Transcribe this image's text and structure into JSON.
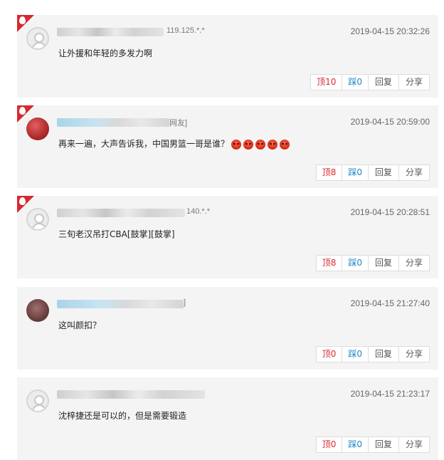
{
  "comments": [
    {
      "hot": true,
      "avatar": "default",
      "user_suffix": "119.125.*.*",
      "time": "2019-04-15 20:32:26",
      "text": "让外援和年轻的多发力啊",
      "emoji_count": 0,
      "up_label": "顶10",
      "down_label": "踩0",
      "reply_label": "回复",
      "share_label": "分享"
    },
    {
      "hot": true,
      "avatar": "red",
      "user_suffix": "网友]",
      "time": "2019-04-15 20:59:00",
      "text": "再来一遍，大声告诉我，中国男篮一哥是谁？",
      "emoji_count": 5,
      "emoji_icon": "angry-face-emoji",
      "up_label": "顶8",
      "down_label": "踩0",
      "reply_label": "回复",
      "share_label": "分享"
    },
    {
      "hot": true,
      "avatar": "default",
      "user_suffix": "140.*.*",
      "time": "2019-04-15 20:28:51",
      "text": "三旬老汉吊打CBA[鼓掌][鼓掌]",
      "emoji_count": 0,
      "up_label": "顶8",
      "down_label": "踩0",
      "reply_label": "回复",
      "share_label": "分享"
    },
    {
      "hot": false,
      "avatar": "brown",
      "user_suffix": "]",
      "time": "2019-04-15 21:27:40",
      "text": "这叫颜扣？",
      "emoji_count": 0,
      "up_label": "顶0",
      "down_label": "踩0",
      "reply_label": "回复",
      "share_label": "分享"
    },
    {
      "hot": false,
      "avatar": "default",
      "user_suffix": "",
      "time": "2019-04-15 21:23:17",
      "text": "沈梓捷还是可以的，但是需要锻造",
      "emoji_count": 0,
      "up_label": "顶0",
      "down_label": "踩0",
      "reply_label": "回复",
      "share_label": "分享"
    }
  ],
  "colors": {
    "hot_badge": "#d8282f",
    "up_text": "#d8282f",
    "down_text": "#1e86c7",
    "card_bg": "#f4f4f4"
  }
}
